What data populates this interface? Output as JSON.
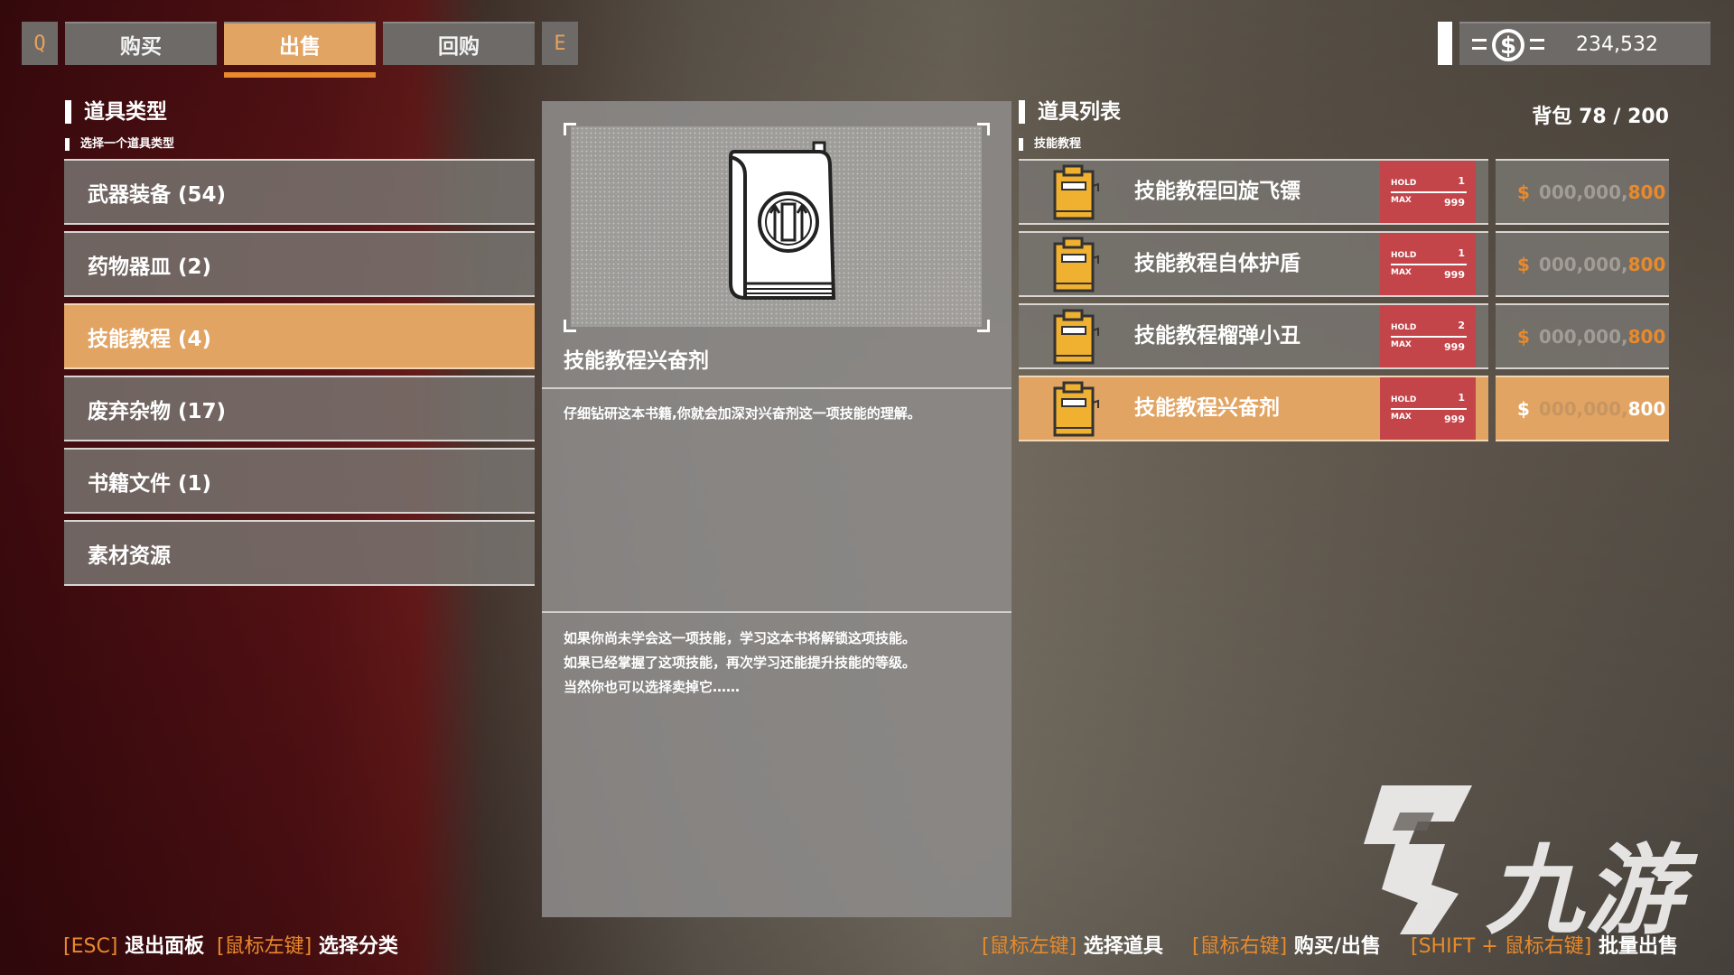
{
  "tabs": {
    "key_left": "Q",
    "key_right": "E",
    "items": [
      "购买",
      "出售",
      "回购"
    ],
    "active_index": 1
  },
  "money": {
    "value": "234,532",
    "icon": "dollar-coin-icon"
  },
  "left": {
    "title": "道具类型",
    "subtitle": "选择一个道具类型",
    "categories": [
      "武器装备 (54)",
      "药物器皿 (2)",
      "技能教程 (4)",
      "废弃杂物 (17)",
      "书籍文件 (1)",
      "素材资源"
    ],
    "active_index": 2
  },
  "detail": {
    "name": "技能教程兴奋剂",
    "description": "仔细钻研这本书籍,你就会加深对兴奋剂这一项技能的理解。",
    "lore": [
      "如果你尚未学会这一项技能，学习这本书将解锁这项技能。",
      "如果已经掌握了这项技能，再次学习还能提升技能的等级。",
      "当然你也可以选择卖掉它……"
    ]
  },
  "right": {
    "title": "道具列表",
    "bag_label": "背包",
    "bag_value": "78 / 200",
    "subtitle": "技能教程",
    "hold_label": "HOLD",
    "max_label": "MAX",
    "currency": "$",
    "items": [
      {
        "name": "技能教程回旋飞镖",
        "hold": "1",
        "max": "999",
        "price_zeros": "000,000,",
        "price": "800"
      },
      {
        "name": "技能教程自体护盾",
        "hold": "1",
        "max": "999",
        "price_zeros": "000,000,",
        "price": "800"
      },
      {
        "name": "技能教程榴弹小丑",
        "hold": "2",
        "max": "999",
        "price_zeros": "000,000,",
        "price": "800"
      },
      {
        "name": "技能教程兴奋剂",
        "hold": "1",
        "max": "999",
        "price_zeros": "000,000,",
        "price": "800"
      }
    ],
    "active_index": 3
  },
  "footer": {
    "left": [
      {
        "key": "[ESC]",
        "action": "退出面板"
      },
      {
        "key": "[鼠标左键]",
        "action": "选择分类"
      }
    ],
    "right": [
      {
        "key": "[鼠标左键]",
        "action": "选择道具"
      },
      {
        "key": "[鼠标右键]",
        "action": "购买/出售"
      },
      {
        "key": "[SHIFT + 鼠标右键]",
        "action": "批量出售"
      }
    ]
  },
  "watermark": {
    "text": "九游"
  },
  "colors": {
    "accent": "#e2a463",
    "key_orange": "#e88a2c",
    "hold_red": "#c3454a",
    "panel_grey": "#6d6a67"
  }
}
